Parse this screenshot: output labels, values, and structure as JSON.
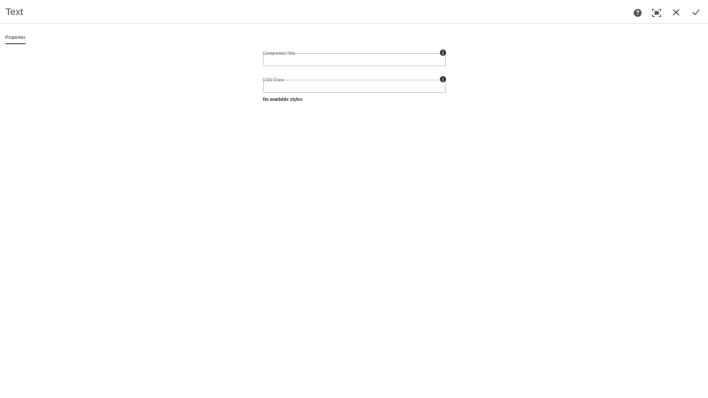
{
  "header": {
    "title": "Text",
    "actions": [
      {
        "icon": "help-icon"
      },
      {
        "icon": "fullscreen-icon"
      },
      {
        "icon": "close-icon"
      },
      {
        "icon": "checkmark-icon"
      }
    ]
  },
  "tabs": [
    {
      "label": "Properties",
      "active": true
    }
  ],
  "form": {
    "component_title": {
      "label": "Component Title",
      "value": "",
      "placeholder": ""
    },
    "css_class": {
      "label": "CSS Class",
      "value": "",
      "placeholder": ""
    },
    "styles_message": "No available styles"
  },
  "colors": {
    "icon": "#4b4b4b",
    "border": "#d4d4d4",
    "text": "#2c2c2c"
  }
}
